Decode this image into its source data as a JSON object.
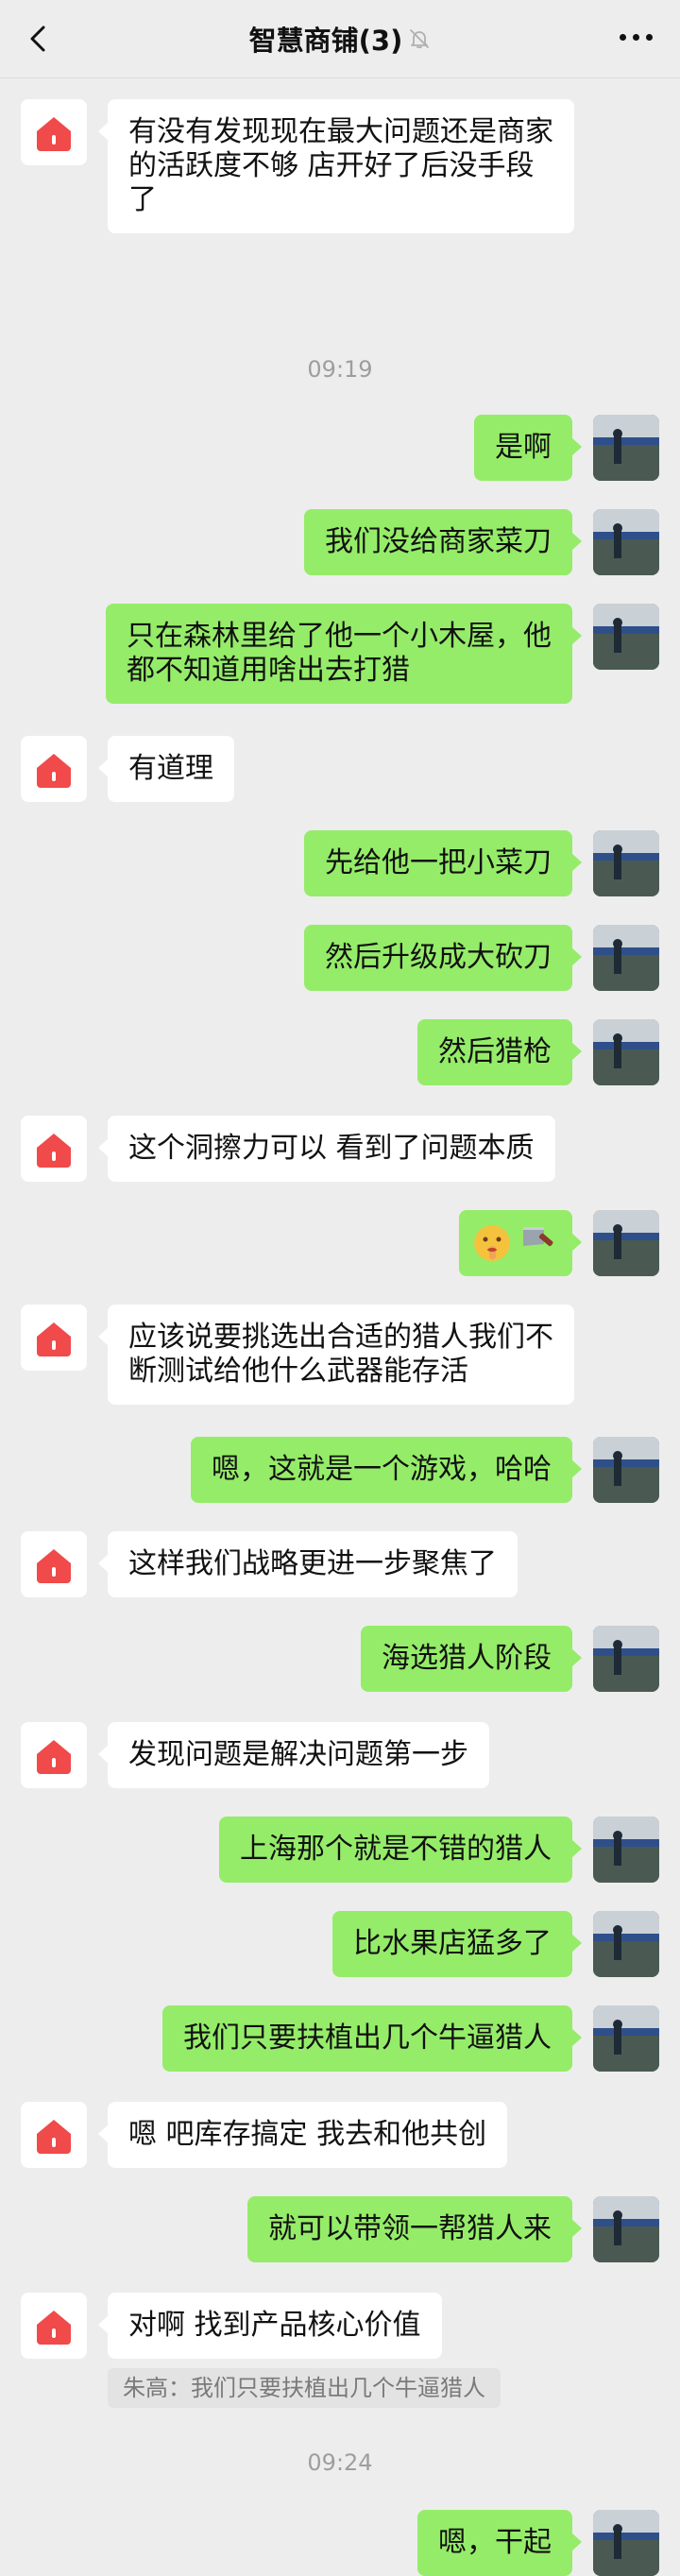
{
  "header": {
    "title": "智慧商铺(3)",
    "back_icon": "chevron-left-icon",
    "mute_icon": "bell-off-icon",
    "more_icon": "more-dots-icon"
  },
  "colors": {
    "background": "#ededed",
    "incoming_bubble": "#ffffff",
    "outgoing_bubble": "#95ec69",
    "shop_avatar_red": "#f04a4a",
    "timestamp_text": "#9e9e9e"
  },
  "messages": [
    {
      "text": "有没有发现现在最大问题还是商家的活跃度不够 店开好了后没手段了"
    },
    {
      "time": "09:19"
    },
    {
      "text": "是啊"
    },
    {
      "text": "我们没给商家菜刀"
    },
    {
      "text": "只在森林里给了他一个小木屋，他都不知道用啥出去打猎"
    },
    {
      "text": "有道理"
    },
    {
      "text": "先给他一把小菜刀"
    },
    {
      "text": "然后升级成大砍刀"
    },
    {
      "text": "然后猎枪"
    },
    {
      "text": "这个洞擦力可以 看到了问题本质"
    },
    {
      "emoji": [
        "shushing-face-emoji",
        "cleaver-emoji"
      ]
    },
    {
      "text": "应该说要挑选出合适的猎人我们不断测试给他什么武器能存活"
    },
    {
      "text": "嗯，这就是一个游戏，哈哈"
    },
    {
      "text": "这样我们战略更进一步聚焦了"
    },
    {
      "text": "海选猎人阶段"
    },
    {
      "text": "发现问题是解决问题第一步"
    },
    {
      "text": "上海那个就是不错的猎人"
    },
    {
      "text": "比水果店猛多了"
    },
    {
      "text": "我们只要扶植出几个牛逼猎人"
    },
    {
      "text": "嗯 吧库存搞定 我去和他共创"
    },
    {
      "text": "就可以带领一帮猎人来"
    },
    {
      "text": "对啊 找到产品核心价值",
      "quote": "朱高：我们只要扶植出几个牛逼猎人"
    },
    {
      "time": "09:24"
    },
    {
      "text": "嗯，干起"
    }
  ]
}
